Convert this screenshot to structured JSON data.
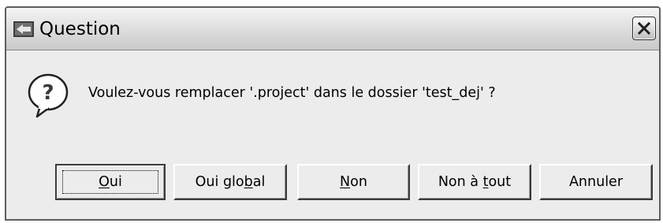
{
  "window": {
    "title": "Question",
    "icon": "eclipse-app-icon",
    "close_icon": "close-icon"
  },
  "message": {
    "icon": "question-icon",
    "text": "Voulez-vous remplacer '.project' dans le dossier 'test_dej' ?"
  },
  "buttons": [
    {
      "label": "Oui",
      "mnemonic": "O",
      "pre": "",
      "key": "O",
      "post": "ui",
      "default": true
    },
    {
      "label": "Oui global",
      "mnemonic": "b",
      "pre": "Oui glo",
      "key": "b",
      "post": "al",
      "default": false
    },
    {
      "label": "Non",
      "mnemonic": "N",
      "pre": "",
      "key": "N",
      "post": "on",
      "default": false
    },
    {
      "label": "Non à tout",
      "mnemonic": "t",
      "pre": "Non à ",
      "key": "t",
      "post": "out",
      "default": false
    },
    {
      "label": "Annuler",
      "mnemonic": "",
      "pre": "Annuler",
      "key": "",
      "post": "",
      "default": false
    }
  ]
}
